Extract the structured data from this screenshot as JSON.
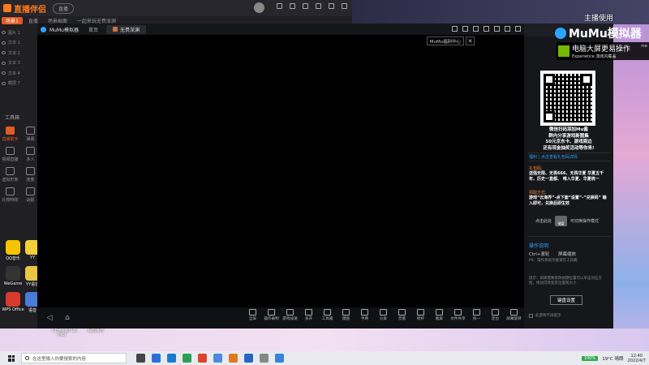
{
  "desktop": {
    "host_label": "主播使用",
    "icons": [
      {
        "label": "QQ音乐",
        "color": "#f5c400"
      },
      {
        "label": "YY",
        "color": "#f2d03a"
      },
      {
        "label": "WeGame",
        "color": "#333333"
      },
      {
        "label": "YY语音",
        "color": "#e8c542"
      },
      {
        "label": "WPS Office",
        "color": "#d83a2d"
      },
      {
        "label": "语音",
        "color": "#4a7bd8"
      }
    ],
    "bottom_labels": [
      "CFHD·客户端",
      "我的世界"
    ],
    "bottom_labels_sub": "(HD)"
  },
  "stream_app": {
    "title": "直播伴侣",
    "pill": "直播",
    "tabs": [
      "场景1",
      "直播",
      "场景画面",
      "一起来玩无畏深渊"
    ],
    "scenes": [
      "图片 1",
      "文本 1",
      "文本 2",
      "文本 3",
      "文本 4",
      "截屏 7"
    ],
    "toolbox_title": "工具箱",
    "tools": [
      {
        "label": "直播助手",
        "active": true
      },
      {
        "label": "弹幕"
      },
      {
        "label": "视频直播"
      },
      {
        "label": "多人"
      },
      {
        "label": "虚拟形象"
      },
      {
        "label": "连麦"
      },
      {
        "label": "礼物特效"
      },
      {
        "label": "战报"
      }
    ]
  },
  "mumu": {
    "title": "MuMu模拟器",
    "home_label": "首页",
    "tab_label": "无畏深渊",
    "center_button": "MuMu福利中心",
    "center_close": "✕",
    "nav": [
      "◁",
      "⌂"
    ],
    "bottom_tools": [
      "全屏",
      "操作录制",
      "游戏加速",
      "多开",
      "工具箱",
      "键盘",
      "手柄",
      "分屏",
      "音量",
      "摇杆",
      "截屏",
      "文件共享",
      "统一",
      "定位",
      "屏幕旋转"
    ]
  },
  "panel": {
    "promo_lines": [
      "微信扫码添加Mu酱",
      "群内分享游戏新图集",
      "50元京东卡、游戏周边",
      "还有现金抽奖活动等你来!"
    ],
    "highlight_head": "福利 | 点击查看礼包码详情",
    "gift_head": "礼包码:",
    "gift_text": "送强无限、无畏666、无畏华夏 华夏五千年、历史一直都、 唯入华夏、华夏统一",
    "how_head": "领取方式:",
    "how_text": "游戏“云海界”-点下面“设置”-“兑换码” 输入即可，兑换后即生效",
    "switch_left": "点击此处",
    "switch_box": "键盘",
    "switch_right": "可切换操作模式",
    "op_title": "操作说明",
    "op_key": "Ctrl+滚轮",
    "op_key_desc": "屏幕缩放",
    "op_note1": "PS：操作系统功能请在工具箱",
    "op_note2": "提示：如果需要修改按键位置可以单击对应方框，拖动可改变其位置或大小",
    "key_button": "键盘设置",
    "no_show": "此游戏不再提示"
  },
  "overlay": {
    "mumu_brand": "MuMu模拟器",
    "nvidia_line1": "电脑大屏更易操作",
    "nvidia_line2": "Experience 游戏内覆盖",
    "nvidia_line3": "rce"
  },
  "taskbar": {
    "search_placeholder": "在这里输入你要搜索的内容",
    "app_colors": [
      "#444444",
      "#2d6fd8",
      "#1f7ac9",
      "#2c9f55",
      "#d9442b",
      "#4a8ae0",
      "#e07a1f",
      "#2a65c2",
      "#888888",
      "#3a82d6",
      "#2d6fd8"
    ],
    "battery": "100%",
    "weather": "19°C 晴朗",
    "time": "12:40",
    "date": "2022/4/7"
  }
}
